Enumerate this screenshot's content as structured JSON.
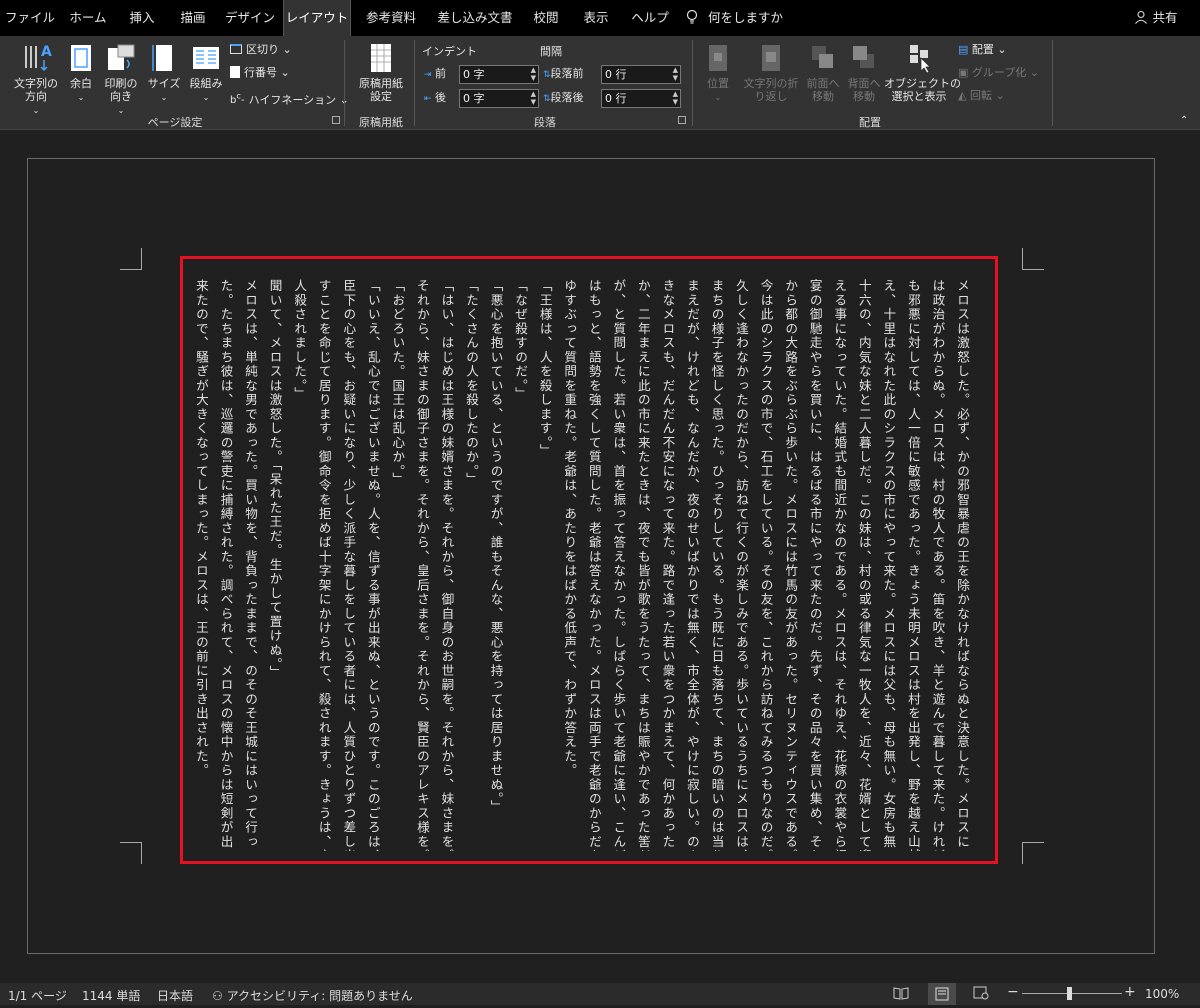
{
  "tabs": [
    "ファイル",
    "ホーム",
    "挿入",
    "描画",
    "デザイン",
    "レイアウト",
    "参考資料",
    "差し込み文書",
    "校閲",
    "表示",
    "ヘルプ"
  ],
  "tell_me": "何をしますか",
  "share": "共有",
  "ribbon": {
    "text_direction": "文字列の\n方向",
    "margins": "余白",
    "orientation": "印刷の\n向き",
    "size": "サイズ",
    "columns": "段組み",
    "breaks": "区切り",
    "line_numbers": "行番号",
    "hyphenation": "ハイフネーション",
    "page_setup": "ページ設定",
    "genko_setting": "原稿用紙\n設定",
    "genko_group": "原稿用紙",
    "indent": "インデント",
    "spacing": "間隔",
    "indent_before_label": "前",
    "indent_before": "0 字",
    "indent_after_label": "後",
    "indent_after": "0 字",
    "space_before_label": "段落前",
    "space_before": "0 行",
    "space_after_label": "段落後",
    "space_after": "0 行",
    "paragraph_group": "段落",
    "position": "位置",
    "wrap_text": "文字列の折\nり返し",
    "bring_forward": "前面へ\n移動",
    "send_backward": "背面へ\n移動",
    "selection_pane": "オブジェクトの\n選択と表示",
    "align": "配置",
    "group": "グループ化",
    "rotate": "回転",
    "arrange_group": "配置"
  },
  "document": {
    "columns": [
      "メロスは激怒した。必ず、かの邪智暴虐の王を除かなければならぬと決意した。メロスに",
      "は政治がわからぬ。メロスは、村の牧人である。笛を吹き、羊と遊んで暮して来た。けれど",
      "も邪悪に対しては、人一倍に敏感であった。きょう未明メロスは村を出発し、野を越え山越",
      "え、十里はなれた此のシラクスの市にやって来た。メロスには父も、母も無い。女房も無い。",
      "十六の、内気な妹と二人暮しだ。この妹は、村の或る律気な一牧人を、近々、花婿として迎",
      "える事になっていた。結婚式も間近かなのである。メロスは、それゆえ、花嫁の衣裳やら祝",
      "宴の御馳走やらを買いに、はるばる市にやって来たのだ。先ず、その品々を買い集め、それ",
      "から都の大路をぶらぶら歩いた。メロスには竹馬の友があった。セリヌンティウスである。",
      "今は此のシラクスの市で、石工をしている。その友を、これから訪ねてみるつもりなのだ。",
      "久しく逢わなかったのだから、訪ねて行くのが楽しみである。歩いているうちにメロスは、",
      "まちの様子を怪しく思った。ひっそりしている。もう既に日も落ちて、まちの暗いのは当り",
      "まえだが、けれども、なんだか、夜のせいばかりでは無く、市全体が、やけに寂しい。のん",
      "きなメロスも、だんだん不安になって来た。路で逢った若い衆をつかまえて、何かあったの",
      "か、二年まえに此の市に来たときは、夜でも皆が歌をうたって、まちは賑やかであった筈だ",
      "が、と質問した。若い衆は、首を振って答えなかった。しばらく歩いて老爺に逢い、こんど",
      "はもっと、語勢を強くして質問した。老爺は答えなかった。メロスは両手で老爺のからだを",
      "ゆすぶって質問を重ねた。老爺は、あたりをはばかる低声で、わずか答えた。",
      "「王様は、人を殺します。」",
      "「なぜ殺すのだ。」",
      "「悪心を抱いている、というのですが、誰もそんな、悪心を持っては居りませぬ。」",
      "「たくさんの人を殺したのか。」",
      "「はい、はじめは王様の妹婿さまを。それから、御自身のお世嗣を。それから、妹さまを。",
      "それから、妹さまの御子さまを。それから、皇后さまを。それから、賢臣のアレキス様を。」",
      "「おどろいた。国王は乱心か。」",
      "「いいえ、乱心ではございませぬ。人を、信ずる事が出来ぬ、というのです。このごろは、",
      "臣下の心をも、お疑いになり、少しく派手な暮しをしている者には、人質ひとりずつ差し出",
      "すことを命じて居ります。御命令を拒めば十字架にかけられて、殺されます。きょうは、六",
      "人殺されました。」",
      "聞いて、メロスは激怒した。「呆れた王だ。生かして置けぬ。」",
      "メロスは、単純な男であった。買い物を、背負ったままで、のそのそ王城にはいって行っ",
      "た。たちまち彼は、巡邏の警吏に捕縛された。調べられて、メロスの懐中からは短剣が出て",
      "来たので、騒ぎが大きくなってしまった。メロスは、王の前に引き出された。"
    ]
  },
  "status": {
    "page": "1/1 ページ",
    "words": "1144 単語",
    "language": "日本語",
    "accessibility": "アクセシビリティ: 問題ありません",
    "zoom": "100%"
  }
}
